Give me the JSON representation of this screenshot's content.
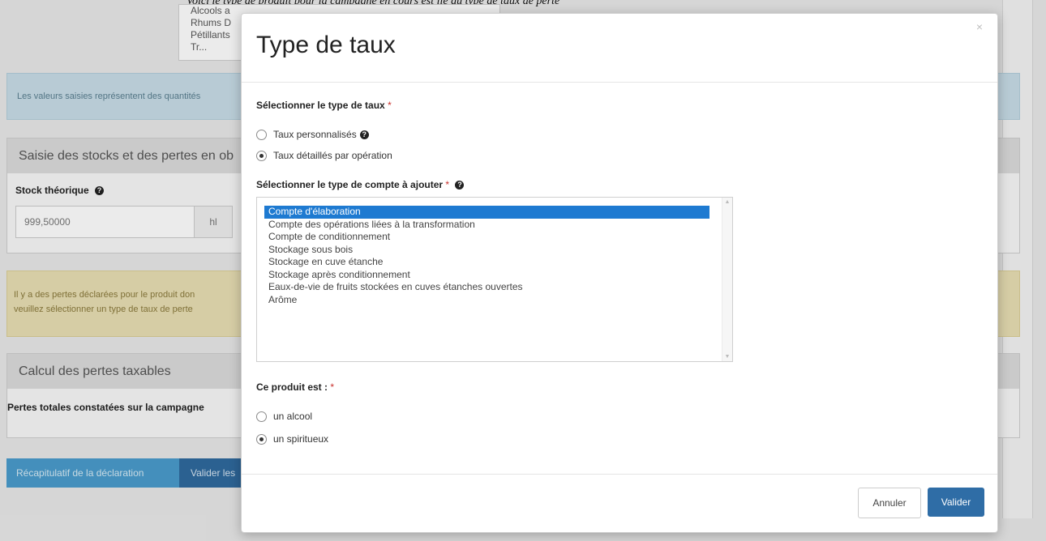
{
  "background": {
    "top_text": "Voici le type de produit pour la campagne en cours est lié au type de taux de perte",
    "dropdown_items": [
      "Alcools a",
      "Rhums D",
      "Pétillants",
      "Tr..."
    ],
    "info_text": "Les valeurs saisies représentent des quantités",
    "stock_section_title": "Saisie des stocks et des pertes en ob",
    "stock_label": "Stock théorique",
    "stock_value": "999,50000",
    "stock_unit": "hl",
    "warning_lines": [
      "Il y a des pertes déclarées pour le produit don",
      "veuillez sélectionner un type de taux de perte"
    ],
    "calc_section_title": "Calcul des pertes taxables",
    "calc_label": "Pertes totales constatées sur la campagne",
    "btn_recap": "Récapitulatif de la déclaration",
    "btn_valider": "Valider les"
  },
  "modal": {
    "title": "Type de taux",
    "close": "×",
    "rate_type_label": "Sélectionner le type de taux",
    "required_mark": "*",
    "rate_options": [
      {
        "label": "Taux personnalisés",
        "checked": false,
        "help": true
      },
      {
        "label": "Taux détaillés par opération",
        "checked": true,
        "help": false
      }
    ],
    "account_type_label": "Sélectionner le type de compte à ajouter",
    "account_options": [
      "Compte d'élaboration",
      "Compte des opérations liées à la transformation",
      "Compte de conditionnement",
      "Stockage sous bois",
      "Stockage en cuve étanche",
      "Stockage après conditionnement",
      "Eaux-de-vie de fruits stockées en cuves étanches ouvertes",
      "Arôme"
    ],
    "account_selected_index": 0,
    "product_label": "Ce produit est :",
    "product_options": [
      {
        "label": "un alcool",
        "checked": false
      },
      {
        "label": "un spiritueux",
        "checked": true
      }
    ],
    "btn_cancel": "Annuler",
    "btn_submit": "Valider"
  },
  "colors": {
    "primary": "#2f6da6",
    "selected": "#1e7ad1",
    "required": "#c9302c"
  }
}
